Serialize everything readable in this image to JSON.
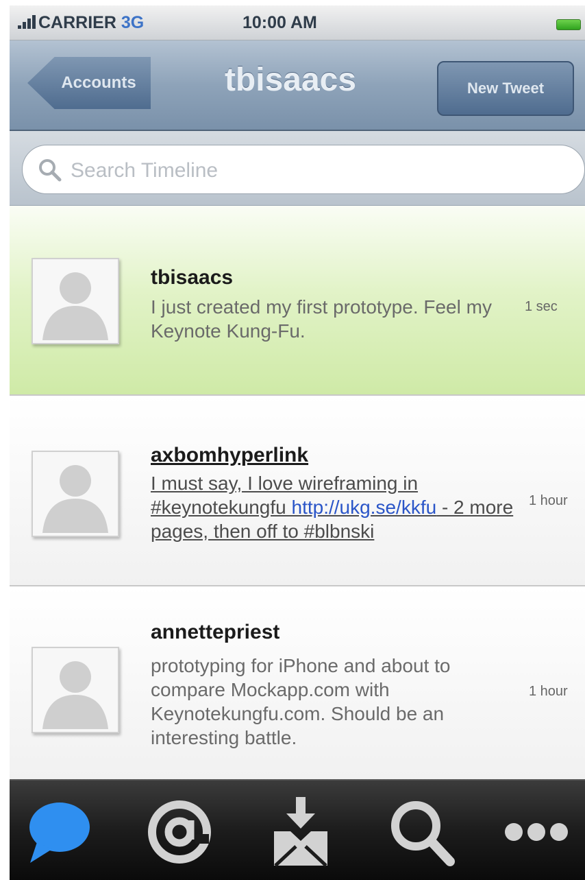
{
  "status_bar": {
    "carrier": "CARRIER",
    "network": "3G",
    "time": "10:00 AM"
  },
  "nav": {
    "back_label": "Accounts",
    "title": "tbisaacs",
    "new_tweet_label": "New Tweet"
  },
  "search": {
    "placeholder": "Search Timeline",
    "icon": "magnifier-icon"
  },
  "tweets": [
    {
      "author": "tbisaacs",
      "text": "I just created my first prototype. Feel my Keynote Kung-Fu.",
      "age": "1 sec"
    },
    {
      "author": "axbomhyperlink",
      "text_before": "I must say, I love wireframing in #keynotekungfu ",
      "link": "http://ukg.se/kkfu",
      "text_after": " - 2 more pages, then off to #blbnski",
      "age": "1 hour"
    },
    {
      "author": "annettepriest",
      "text": "prototyping for iPhone and about to compare Mockapp.com with Keynotekungfu.com. Should be an interesting battle.",
      "age": "1 hour"
    }
  ],
  "tab_bar": {
    "tabs": [
      {
        "icon": "speech-bubble-icon",
        "active": true
      },
      {
        "icon": "at-sign-icon",
        "active": false
      },
      {
        "icon": "inbox-download-icon",
        "active": false
      },
      {
        "icon": "search-icon",
        "active": false
      },
      {
        "icon": "more-icon",
        "active": false
      }
    ],
    "active_color": "#2f8ff0",
    "inactive_color": "#d2d2d2"
  }
}
